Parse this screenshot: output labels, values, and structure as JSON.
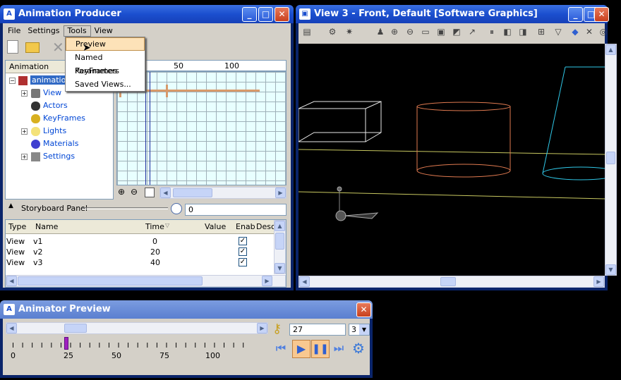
{
  "producer": {
    "title": "Animation Producer",
    "menu": [
      "File",
      "Settings",
      "Tools",
      "View"
    ],
    "tools_menu": [
      "Preview",
      "Named KeyFrames",
      "Parameters",
      "Saved Views..."
    ],
    "tree_header": "Animation",
    "tree_root": "animation",
    "tree_items": [
      "View",
      "Actors",
      "KeyFrames",
      "Lights",
      "Materials",
      "Settings"
    ],
    "timeline_ticks": [
      "50",
      "100"
    ],
    "storyboard_label": "Storyboard Panel",
    "storyboard_time": "0",
    "columns": [
      "Type",
      "Name",
      "Time",
      "Value",
      "Enab",
      "Desc"
    ],
    "rows": [
      {
        "type": "View",
        "name": "v1",
        "time": "0"
      },
      {
        "type": "View",
        "name": "v2",
        "time": "20"
      },
      {
        "type": "View",
        "name": "v3",
        "time": "40"
      }
    ]
  },
  "view3": {
    "title": "View 3 - Front, Default [Software Graphics]"
  },
  "preview": {
    "title": "Animator Preview",
    "frame": "27",
    "step": "3",
    "ticks": [
      "0",
      "25",
      "50",
      "75",
      "100"
    ],
    "position_fraction": 0.27
  },
  "colors": {
    "titlebar": "#1b4fcf",
    "window_bg": "#d4d0c8",
    "accent_orange": "#e0a070",
    "scrub_marker": "#a020c0"
  }
}
